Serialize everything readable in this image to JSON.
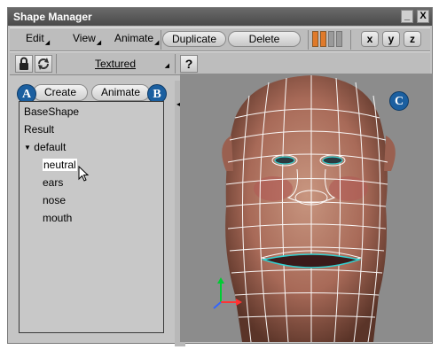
{
  "window": {
    "title": "Shape Manager",
    "minimize_glyph": "_",
    "close_glyph": "X"
  },
  "toolbar": {
    "menus": [
      "Edit",
      "View",
      "Animate"
    ],
    "duplicate_label": "Duplicate",
    "delete_label": "Delete",
    "axes": [
      "x",
      "y",
      "z"
    ],
    "colors": {
      "orange": "#e07a2a",
      "gray": "#9a9a9a"
    }
  },
  "view_bar": {
    "display_mode": "Textured",
    "help_glyph": "?"
  },
  "tabs": {
    "create_label": "Create",
    "animate_label": "Animate"
  },
  "callouts": [
    "A",
    "B",
    "C"
  ],
  "tree": {
    "items": [
      "BaseShape",
      "Result",
      "default",
      "neutral",
      "ears",
      "nose",
      "mouth"
    ],
    "selected": "neutral"
  },
  "viewport": {
    "mesh_color": "#ffffff",
    "skin_color": "#c88c70"
  },
  "gizmo": {
    "colors": {
      "y": "#00cc33",
      "x": "#ff3333",
      "z": "#3366ff"
    }
  }
}
